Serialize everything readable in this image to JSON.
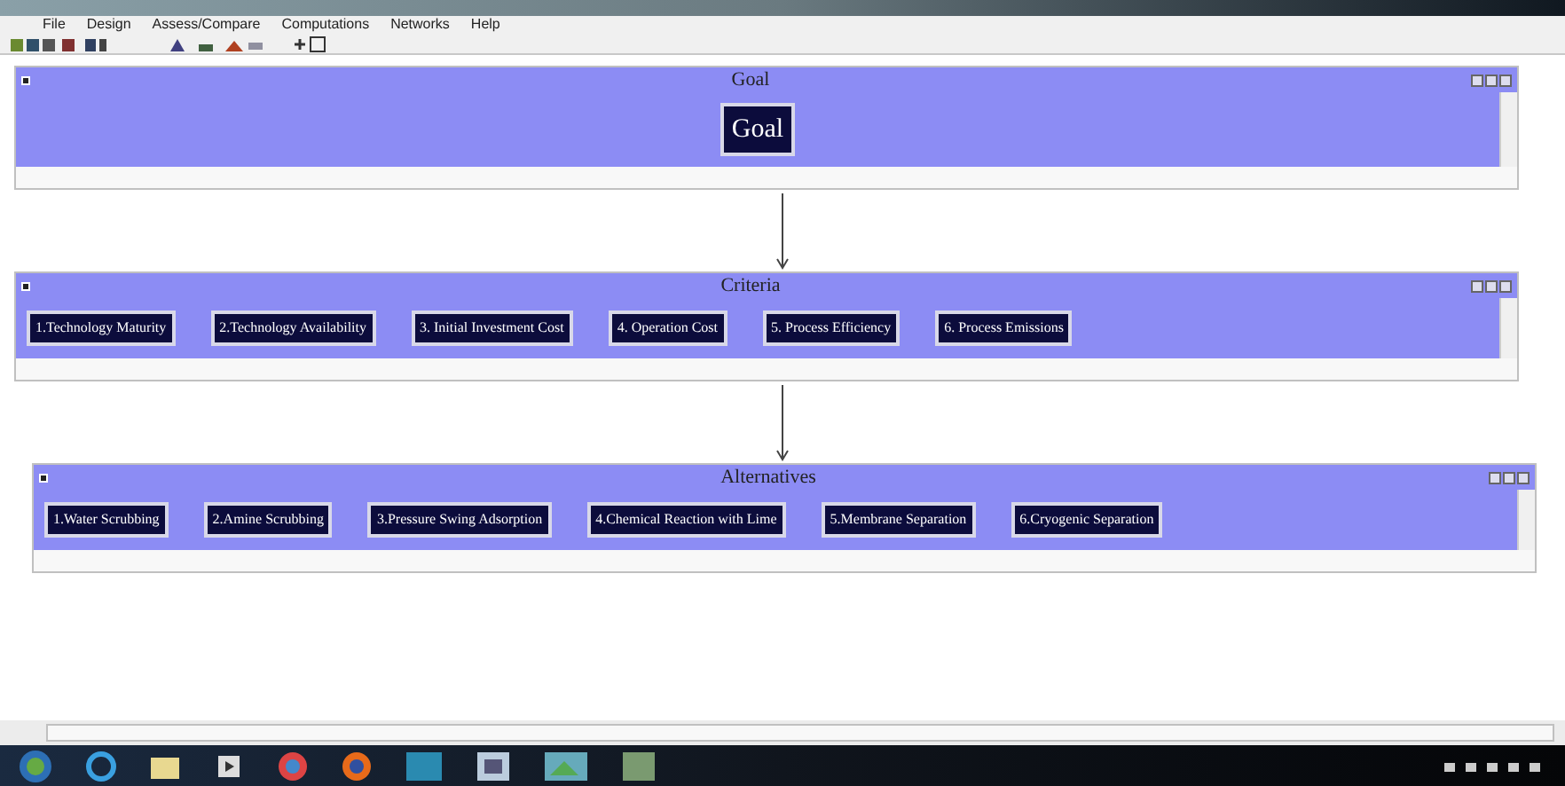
{
  "menu": [
    "File",
    "Design",
    "Assess/Compare",
    "Computations",
    "Networks",
    "Help"
  ],
  "clusters": [
    {
      "title": "Goal",
      "nodes": [
        "Goal"
      ],
      "large": true
    },
    {
      "title": "Criteria",
      "nodes": [
        "1.Technology Maturity",
        "2.Technology Availability",
        "3. Initial Investment Cost",
        "4. Operation Cost",
        "5. Process Efficiency",
        "6. Process Emissions"
      ],
      "large": false
    },
    {
      "title": "Alternatives",
      "nodes": [
        "1.Water Scrubbing",
        "2.Amine Scrubbing",
        "3.Pressure Swing Adsorption",
        "4.Chemical Reaction with Lime",
        "5.Membrane Separation",
        "6.Cryogenic Separation"
      ],
      "large": false
    }
  ]
}
